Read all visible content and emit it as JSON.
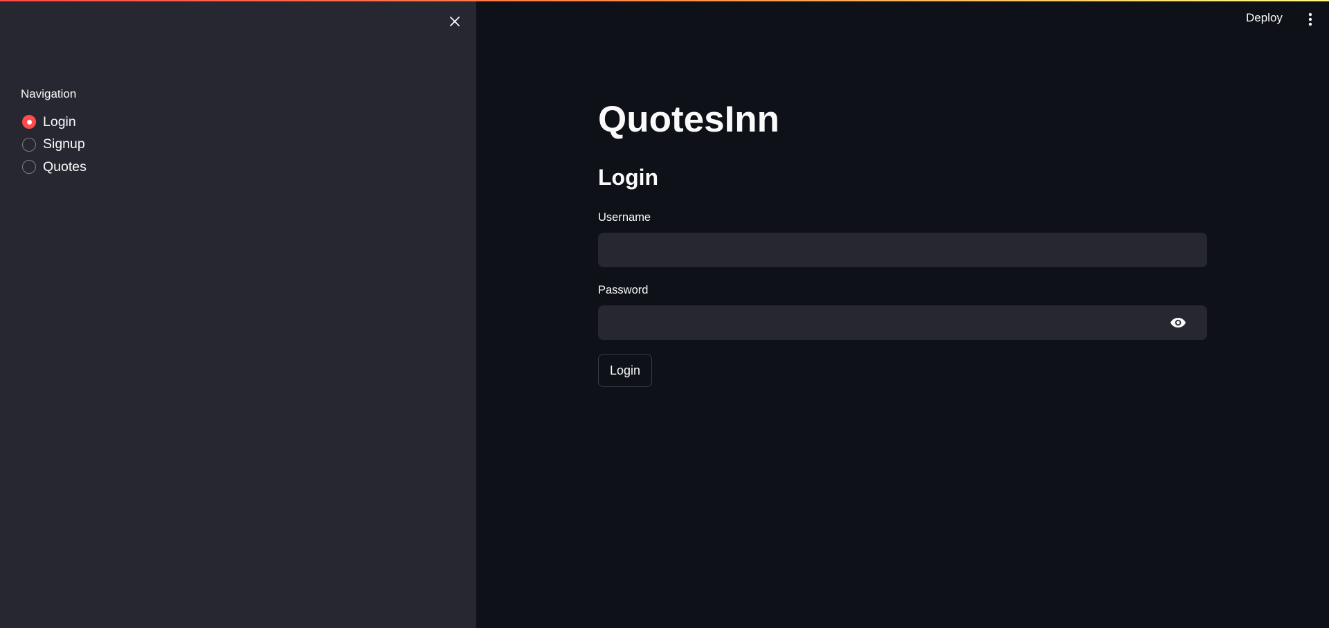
{
  "sidebar": {
    "close_icon": "close-icon",
    "navigation_label": "Navigation",
    "options": [
      {
        "label": "Login",
        "selected": true
      },
      {
        "label": "Signup",
        "selected": false
      },
      {
        "label": "Quotes",
        "selected": false
      }
    ]
  },
  "header": {
    "deploy_label": "Deploy",
    "menu_icon": "more-vertical-icon"
  },
  "main": {
    "title": "QuotesInn",
    "section_title": "Login",
    "username_label": "Username",
    "username_value": "",
    "password_label": "Password",
    "password_value": "",
    "password_toggle_icon": "eye-icon",
    "login_button_label": "Login"
  },
  "colors": {
    "accent": "#ff4b4b",
    "background": "#0e1117",
    "sidebar_background": "#262730",
    "input_background": "#262730",
    "text": "#fafafa"
  }
}
